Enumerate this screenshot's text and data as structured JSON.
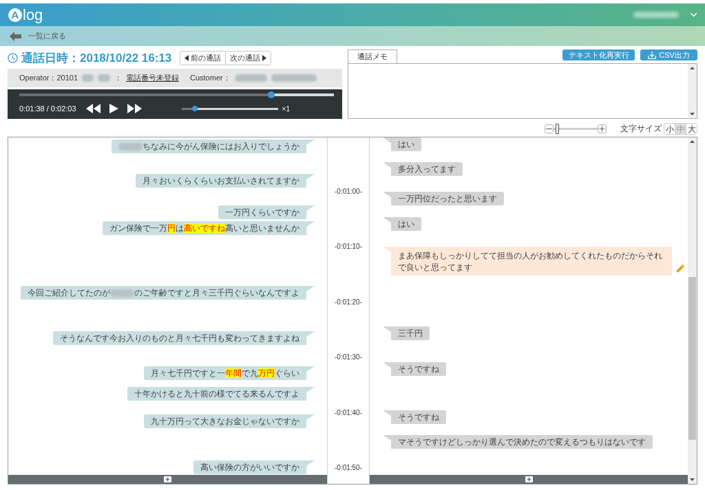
{
  "header": {
    "logo_mark": "A",
    "logo_text": "log"
  },
  "back_link": {
    "label": "一覧に戻る"
  },
  "call": {
    "title": "通話日時：2018/10/22 16:13",
    "nav": [
      {
        "kind": "prev",
        "label": "前の通話"
      },
      {
        "kind": "next",
        "label": "次の通話"
      }
    ]
  },
  "info_bar": [
    {
      "kind": "text",
      "text": "Operator：20101"
    },
    {
      "kind": "redacted"
    },
    {
      "kind": "redacted"
    },
    {
      "kind": "text",
      "text": "："
    },
    {
      "kind": "link",
      "text": "電話番号未登録"
    },
    {
      "kind": "text",
      "text": "Customer："
    },
    {
      "kind": "redacted"
    },
    {
      "kind": "redacted"
    }
  ],
  "player": {
    "progress": {
      "level": 0.8
    },
    "time": "0:01:38 / 0:02:03",
    "controls": [
      {
        "kind": "rewind"
      },
      {
        "kind": "play"
      },
      {
        "kind": "forward"
      }
    ],
    "speed": {
      "level": 0.14
    },
    "speed_label": "×1"
  },
  "memo": {
    "tab": "通話メモ"
  },
  "actions": [
    {
      "kind": "text",
      "label": "テキスト化再実行"
    },
    {
      "kind": "download",
      "label": "CSV出力"
    }
  ],
  "zoom": {
    "level": 0.05
  },
  "font_size": {
    "label": "文字サイズ",
    "options": [
      {
        "label": "小",
        "selected": false
      },
      {
        "label": "中",
        "selected": true
      },
      {
        "label": "大",
        "selected": false
      }
    ]
  },
  "transcript": {
    "operator": [
      {
        "segments": [
          {
            "kind": "redacted"
          },
          {
            "kind": "text",
            "text": "ちなみに今がん保険にはお入りでしょうか"
          }
        ]
      },
      {
        "segments": [
          {
            "kind": "text",
            "text": "月々おいくらくらいお支払いされてますか"
          }
        ]
      },
      {
        "segments": [
          {
            "kind": "text",
            "text": "一万円くらいですか"
          }
        ]
      },
      {
        "segments": [
          {
            "kind": "text",
            "text": "ガン保険で一万"
          },
          {
            "kind": "keyword",
            "text": "円"
          },
          {
            "kind": "text",
            "text": "は"
          },
          {
            "kind": "keyword",
            "text": "高いですね"
          },
          {
            "kind": "text",
            "text": "高いと思いませんか"
          }
        ]
      },
      {
        "segments": [
          {
            "kind": "text",
            "text": "今回ご紹介してたのが"
          },
          {
            "kind": "redacted"
          },
          {
            "kind": "text",
            "text": "のご年齢ですと月々三千円ぐらいなんですよ"
          }
        ]
      },
      {
        "segments": [
          {
            "kind": "text",
            "text": "そうなんです今お入りのものと月々七千円も変わってきますよね"
          }
        ]
      },
      {
        "segments": [
          {
            "kind": "text",
            "text": "月々七千円ですと一"
          },
          {
            "kind": "keyword",
            "text": "年間"
          },
          {
            "kind": "text",
            "text": "で九"
          },
          {
            "kind": "keyword",
            "text": "万円"
          },
          {
            "kind": "text",
            "text": "ぐらい"
          }
        ]
      },
      {
        "segments": [
          {
            "kind": "text",
            "text": "十年かけると九十前の様でてる来るんですよ"
          }
        ]
      },
      {
        "segments": [
          {
            "kind": "text",
            "text": "九十万円って大きなお金じゃないですか"
          }
        ]
      },
      {
        "segments": [
          {
            "kind": "text",
            "text": "高い保険の方がいいですか"
          }
        ]
      }
    ],
    "timeline": [
      "-0:01:00-",
      "-0:01:10-",
      "-0:01:20-",
      "-0:01:30-",
      "-0:01:40-",
      "-0:01:50-"
    ],
    "customer": [
      {
        "text": "はい",
        "editing": false
      },
      {
        "text": "多分入ってます",
        "editing": false
      },
      {
        "text": "一万円位だったと思います",
        "editing": false
      },
      {
        "text": "はい",
        "editing": false
      },
      {
        "text": "まあ保障もしっかりしてて担当の人がお勧めしてくれたものだからそれで良いと思ってます",
        "editing": true
      },
      {
        "text": "三千円",
        "editing": false
      },
      {
        "text": "そうですね",
        "editing": false
      },
      {
        "text": "そうですね",
        "editing": false
      },
      {
        "text": "マそうですけどしっかり選んで決めたので変えるつもりはないです",
        "editing": false
      }
    ]
  }
}
